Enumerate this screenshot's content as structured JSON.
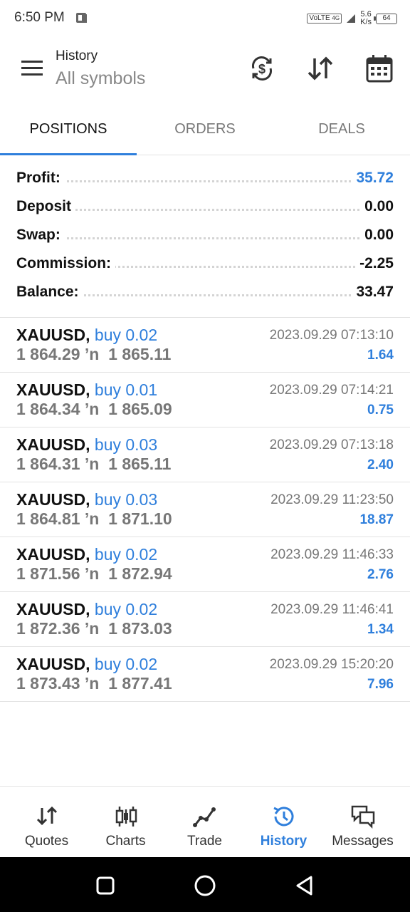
{
  "status_bar": {
    "time": "6:50 PM",
    "network": "VoLTE",
    "signal_label": "4G",
    "speed_value": "5.6",
    "speed_unit": "K/s",
    "battery": "64"
  },
  "header": {
    "title": "History",
    "subtitle": "All symbols",
    "icons": [
      "menu-icon",
      "currency-sync-icon",
      "sort-icon",
      "calendar-icon"
    ]
  },
  "tabs": [
    {
      "label": "POSITIONS",
      "active": true
    },
    {
      "label": "ORDERS",
      "active": false
    },
    {
      "label": "DEALS",
      "active": false
    }
  ],
  "summary": [
    {
      "label": "Profit:",
      "value": "35.72"
    },
    {
      "label": "Deposit",
      "value": "0.00"
    },
    {
      "label": "Swap:",
      "value": "0.00"
    },
    {
      "label": "Commission:",
      "value": "-2.25"
    },
    {
      "label": "Balance:",
      "value": "33.47"
    }
  ],
  "positions": [
    {
      "symbol": "XAUUSD,",
      "type": "buy 0.02",
      "open": "1 864.29",
      "arrow": "’n",
      "close": "1 865.11",
      "time": "2023.09.29 07:13:10",
      "profit": "1.64"
    },
    {
      "symbol": "XAUUSD,",
      "type": "buy 0.01",
      "open": "1 864.34",
      "arrow": "’n",
      "close": "1 865.09",
      "time": "2023.09.29 07:14:21",
      "profit": "0.75"
    },
    {
      "symbol": "XAUUSD,",
      "type": "buy 0.03",
      "open": "1 864.31",
      "arrow": "’n",
      "close": "1 865.11",
      "time": "2023.09.29 07:13:18",
      "profit": "2.40"
    },
    {
      "symbol": "XAUUSD,",
      "type": "buy 0.03",
      "open": "1 864.81",
      "arrow": "’n",
      "close": "1 871.10",
      "time": "2023.09.29 11:23:50",
      "profit": "18.87"
    },
    {
      "symbol": "XAUUSD,",
      "type": "buy 0.02",
      "open": "1 871.56",
      "arrow": "’n",
      "close": "1 872.94",
      "time": "2023.09.29 11:46:33",
      "profit": "2.76"
    },
    {
      "symbol": "XAUUSD,",
      "type": "buy 0.02",
      "open": "1 872.36",
      "arrow": "’n",
      "close": "1 873.03",
      "time": "2023.09.29 11:46:41",
      "profit": "1.34"
    },
    {
      "symbol": "XAUUSD,",
      "type": "buy 0.02",
      "open": "1 873.43",
      "arrow": "’n",
      "close": "1 877.41",
      "time": "2023.09.29 15:20:20",
      "profit": "7.96"
    }
  ],
  "bottom_nav": [
    {
      "label": "Quotes",
      "icon": "quotes-icon",
      "active": false
    },
    {
      "label": "Charts",
      "icon": "charts-icon",
      "active": false
    },
    {
      "label": "Trade",
      "icon": "trade-icon",
      "active": false
    },
    {
      "label": "History",
      "icon": "history-icon",
      "active": true
    },
    {
      "label": "Messages",
      "icon": "messages-icon",
      "active": false
    }
  ],
  "colors": {
    "accent": "#2f7fdc",
    "text": "#111111",
    "muted": "#777777"
  }
}
